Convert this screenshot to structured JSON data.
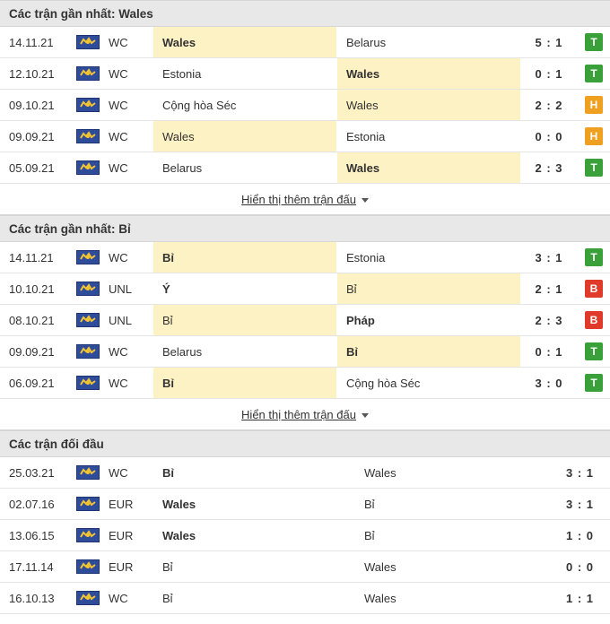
{
  "sections": [
    {
      "title": "Các trận gần nhất: Wales",
      "more": "Hiển thị thêm trận đấu",
      "matches": [
        {
          "date": "14.11.21",
          "league": "WC",
          "home": "Wales",
          "away": "Belarus",
          "score": "5 : 1",
          "result": "T"
        },
        {
          "date": "12.10.21",
          "league": "WC",
          "home": "Estonia",
          "away": "Wales",
          "score": "0 : 1",
          "result": "T"
        },
        {
          "date": "09.10.21",
          "league": "WC",
          "home": "Cộng hòa Séc",
          "away": "Wales",
          "score": "2 : 2",
          "result": "H"
        },
        {
          "date": "09.09.21",
          "league": "WC",
          "home": "Wales",
          "away": "Estonia",
          "score": "0 : 0",
          "result": "H"
        },
        {
          "date": "05.09.21",
          "league": "WC",
          "home": "Belarus",
          "away": "Wales",
          "score": "2 : 3",
          "result": "T"
        }
      ]
    },
    {
      "title": "Các trận gần nhất: Bỉ",
      "more": "Hiển thị thêm trận đấu",
      "matches": [
        {
          "date": "14.11.21",
          "league": "WC",
          "home": "Bỉ",
          "away": "Estonia",
          "score": "3 : 1",
          "result": "T"
        },
        {
          "date": "10.10.21",
          "league": "UNL",
          "home": "Ý",
          "away": "Bỉ",
          "score": "2 : 1",
          "result": "B"
        },
        {
          "date": "08.10.21",
          "league": "UNL",
          "home": "Bỉ",
          "away": "Pháp",
          "score": "2 : 3",
          "result": "B"
        },
        {
          "date": "09.09.21",
          "league": "WC",
          "home": "Belarus",
          "away": "Bỉ",
          "score": "0 : 1",
          "result": "T"
        },
        {
          "date": "06.09.21",
          "league": "WC",
          "home": "Bỉ",
          "away": "Cộng hòa Séc",
          "score": "3 : 0",
          "result": "T"
        }
      ]
    }
  ],
  "h2h": {
    "title": "Các trận đối đầu",
    "matches": [
      {
        "date": "25.03.21",
        "league": "WC",
        "home": "Bỉ",
        "away": "Wales",
        "score": "3 : 1"
      },
      {
        "date": "02.07.16",
        "league": "EUR",
        "home": "Wales",
        "away": "Bỉ",
        "score": "3 : 1"
      },
      {
        "date": "13.06.15",
        "league": "EUR",
        "home": "Wales",
        "away": "Bỉ",
        "score": "1 : 0"
      },
      {
        "date": "17.11.14",
        "league": "EUR",
        "home": "Bỉ",
        "away": "Wales",
        "score": "0 : 0"
      },
      {
        "date": "16.10.13",
        "league": "WC",
        "home": "Bỉ",
        "away": "Wales",
        "score": "1 : 1"
      }
    ]
  },
  "flag_icon": "fifa-globe-icon",
  "colors": {
    "win": "#3aa13a",
    "draw": "#f0a020",
    "loss": "#e03b2a",
    "highlight": "#fdf2c4",
    "header_bg": "#e8e8e8"
  }
}
